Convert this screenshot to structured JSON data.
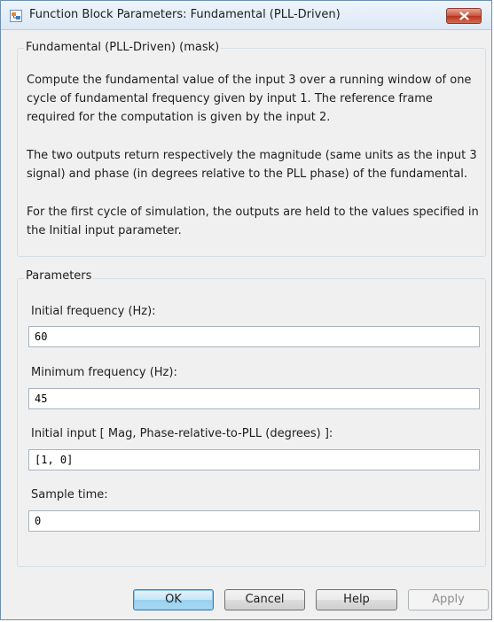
{
  "window": {
    "title": "Function Block Parameters: Fundamental (PLL-Driven)"
  },
  "description": {
    "group_label": "Fundamental (PLL-Driven) (mask)",
    "paragraphs": [
      "Compute the fundamental value of the input 3 over a running window of one cycle of fundamental frequency given by input 1. The reference frame required for the computation is given by the input 2.",
      "The two outputs return respectively the magnitude (same units as the input 3 signal) and phase (in degrees relative to the PLL phase) of the fundamental.",
      "For the first cycle of simulation, the outputs are held to the values specified in the Initial input parameter."
    ]
  },
  "parameters": {
    "group_label": "Parameters",
    "fields": [
      {
        "label": "Initial frequency (Hz):",
        "value": "60"
      },
      {
        "label": "Minimum frequency (Hz):",
        "value": "45"
      },
      {
        "label": "Initial input [ Mag,  Phase-relative-to-PLL (degrees) ]:",
        "value": "[1, 0]"
      },
      {
        "label": "Sample time:",
        "value": "0"
      }
    ]
  },
  "buttons": {
    "ok": "OK",
    "cancel": "Cancel",
    "help": "Help",
    "apply": "Apply"
  }
}
